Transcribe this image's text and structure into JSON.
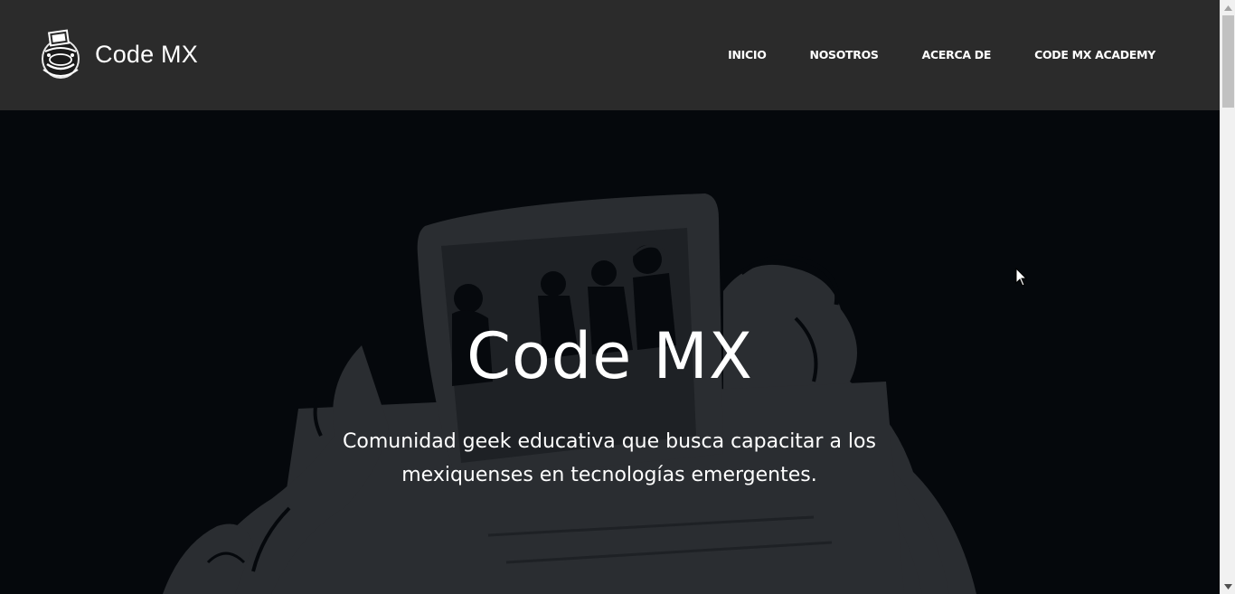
{
  "brand": {
    "name": "Code MX",
    "logo_icon": "code-mx-logo-icon"
  },
  "nav": {
    "items": [
      {
        "label": "INICIO"
      },
      {
        "label": "NOSOTROS"
      },
      {
        "label": "ACERCA DE"
      },
      {
        "label": "CODE MX ACADEMY"
      }
    ]
  },
  "hero": {
    "title": "Code MX",
    "subtitle": "Comunidad geek educativa que busca capacitar a los mexiquenses en tecnologías emergentes.",
    "background_art": "laptop-with-people-illustration"
  },
  "colors": {
    "navbar_bg": "#2b2b2b",
    "hero_bg": "#05080c",
    "hero_art": "#2a2d31",
    "text": "#ffffff",
    "scrollbar_thumb": "#c1c1c1"
  }
}
